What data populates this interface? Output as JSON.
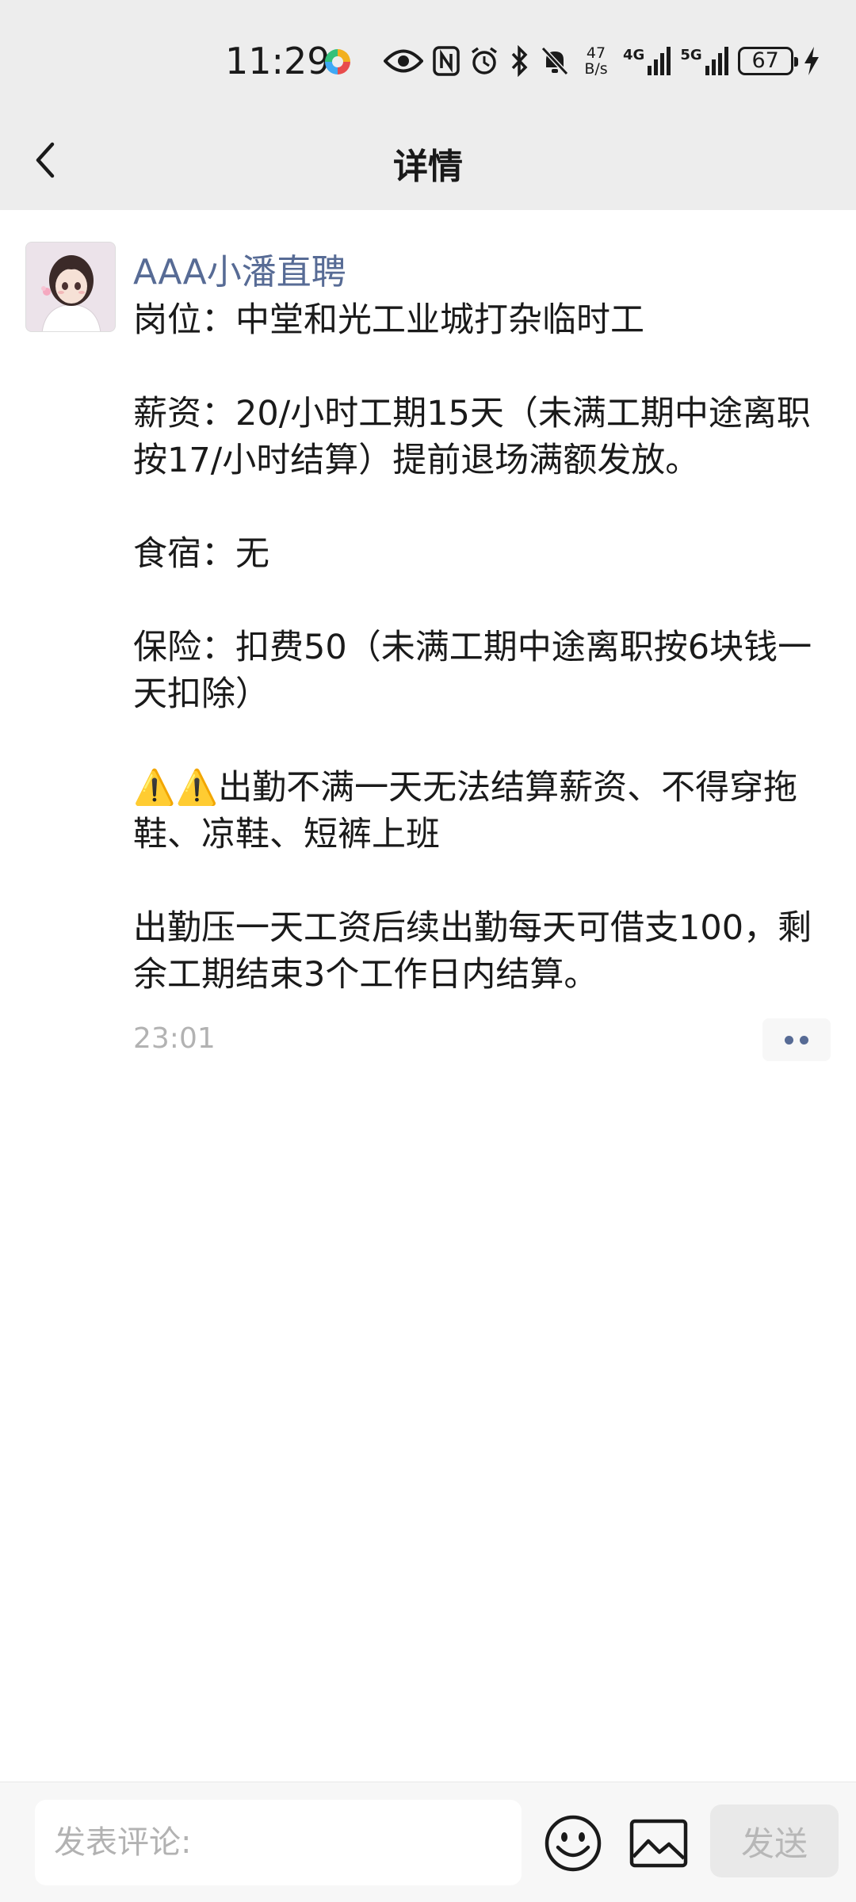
{
  "status_bar": {
    "time": "11:29",
    "net_speed_value": "47",
    "net_speed_unit": "B/s",
    "sim1_label": "4G",
    "sim2_label": "5G",
    "battery": "67",
    "icons": [
      "colorful-app-icon",
      "eye-icon",
      "nfc-icon",
      "alarm-icon",
      "bluetooth-icon",
      "mute-icon",
      "signal-4g-icon",
      "signal-5g-icon",
      "battery-icon",
      "charging-icon"
    ]
  },
  "nav": {
    "back_icon": "chevron-left-icon",
    "title": "详情"
  },
  "post": {
    "username": "AAA小潘直聘",
    "content": "岗位：中堂和光工业城打杂临时工\n\n薪资：20/小时工期15天（未满工期中途离职按17/小时结算）提前退场满额发放。\n\n食宿：无\n\n保险：扣费50（未满工期中途离职按6块钱一天扣除）\n\n⚠️⚠️出勤不满一天无法结算薪资、不得穿拖鞋、凉鞋、短裤上班\n\n出勤压一天工资后续出勤每天可借支100，剩余工期结束3个工作日内结算。",
    "time": "23:01"
  },
  "comment_bar": {
    "placeholder": "发表评论:",
    "emoji_icon": "emoji-icon",
    "image_icon": "image-icon",
    "send_label": "发送"
  },
  "colors": {
    "link_blue": "#576b95",
    "header_bg": "#ededed",
    "muted_text": "#b2b2b2"
  }
}
